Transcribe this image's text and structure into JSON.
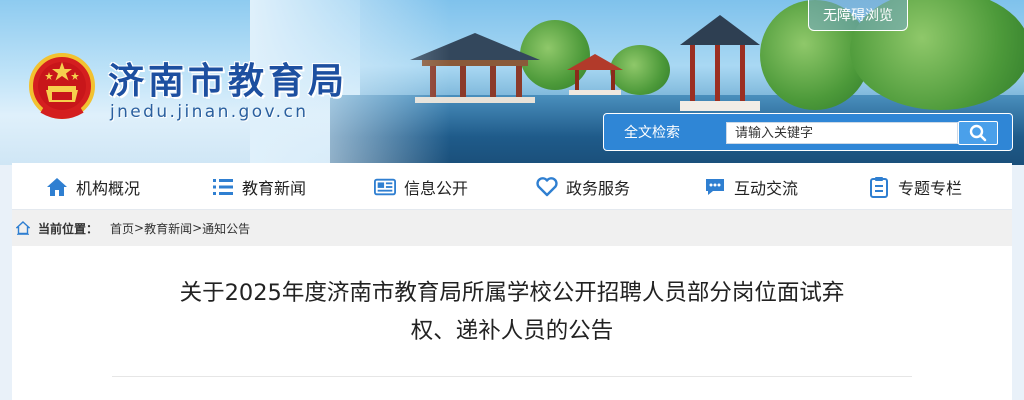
{
  "header": {
    "site_title": "济南市教育局",
    "site_domain": "jnedu.jinan.gov.cn",
    "accessibility_label": "无障碍浏览",
    "search": {
      "label": "全文检索",
      "placeholder": "请输入关键字",
      "value": ""
    }
  },
  "nav": {
    "items": [
      {
        "label": "机构概况",
        "icon": "home-icon"
      },
      {
        "label": "教育新闻",
        "icon": "list-icon"
      },
      {
        "label": "信息公开",
        "icon": "document-icon"
      },
      {
        "label": "政务服务",
        "icon": "heart-icon"
      },
      {
        "label": "互动交流",
        "icon": "chat-icon"
      },
      {
        "label": "专题专栏",
        "icon": "clipboard-icon"
      }
    ]
  },
  "breadcrumb": {
    "label": "当前位置：",
    "items": [
      "首页",
      "教育新闻",
      "通知公告"
    ],
    "separator": ">"
  },
  "article": {
    "title_line1": "关于2025年度济南市教育局所属学校公开招聘人员部分岗位面试弃",
    "title_line2": "权、递补人员的公告"
  },
  "colors": {
    "accent": "#2f86d6",
    "nav_icon": "#2f7fd1",
    "title_blue": "#1d4fa0"
  }
}
